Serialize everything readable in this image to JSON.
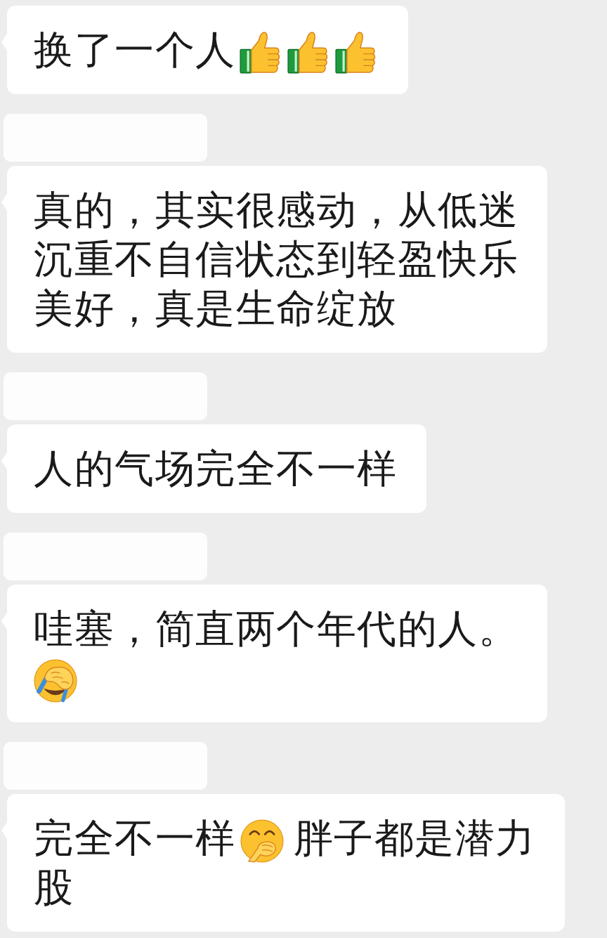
{
  "messages": [
    {
      "sender_name_hidden": false,
      "content": [
        {
          "kind": "text",
          "text": "换了一个人"
        },
        {
          "kind": "thumbs-up"
        },
        {
          "kind": "thumbs-up"
        },
        {
          "kind": "thumbs-up"
        }
      ]
    },
    {
      "sender_name_hidden": true,
      "content": [
        {
          "kind": "text",
          "text": "真的，其实很感动，从低迷沉重不自信状态到轻盈快乐美好，真是生命绽放"
        }
      ]
    },
    {
      "sender_name_hidden": true,
      "content": [
        {
          "kind": "text",
          "text": "人的气场完全不一样"
        }
      ]
    },
    {
      "sender_name_hidden": true,
      "content": [
        {
          "kind": "text",
          "text": "哇塞，简直两个年代的人。"
        },
        {
          "kind": "facepalm"
        }
      ]
    },
    {
      "sender_name_hidden": true,
      "content": [
        {
          "kind": "text",
          "text": "完全不一样"
        },
        {
          "kind": "hand-over-mouth"
        },
        {
          "kind": "text",
          "text": "胖子都是潜力股"
        }
      ]
    }
  ]
}
